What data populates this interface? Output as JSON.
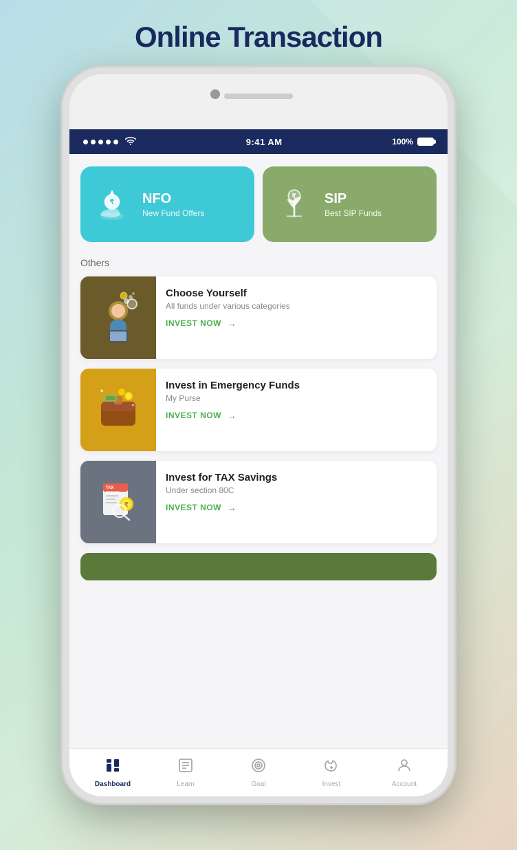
{
  "page": {
    "title": "Online Transaction",
    "background_gradient": "linear-gradient(135deg, #b8dde8, #c5e8d5, #d4ecd8, #e8d4c0)"
  },
  "status_bar": {
    "time": "9:41 AM",
    "battery": "100%",
    "signal_dots": 5
  },
  "top_cards": [
    {
      "id": "nfo",
      "title": "NFO",
      "subtitle": "New Fund Offers",
      "color": "#3ec9d6",
      "icon": "nfo-icon"
    },
    {
      "id": "sip",
      "title": "SIP",
      "subtitle": "Best SIP Funds",
      "color": "#8aaa6b",
      "icon": "sip-icon"
    }
  ],
  "others_label": "Others",
  "list_items": [
    {
      "title": "Choose Yourself",
      "subtitle": "All funds under various categories",
      "cta": "INVEST NOW",
      "bg_color": "brown",
      "icon": "choose-yourself-icon"
    },
    {
      "title": "Invest in Emergency Funds",
      "subtitle": "My Purse",
      "cta": "INVEST NOW",
      "bg_color": "gold",
      "icon": "emergency-funds-icon"
    },
    {
      "title": "Invest for TAX Savings",
      "subtitle": "Under section 80C",
      "cta": "INVEST NOW",
      "bg_color": "slate",
      "icon": "tax-savings-icon"
    }
  ],
  "bottom_nav": [
    {
      "id": "dashboard",
      "label": "Dashboard",
      "active": true
    },
    {
      "id": "learn",
      "label": "Learn",
      "active": false
    },
    {
      "id": "goal",
      "label": "Goal",
      "active": false
    },
    {
      "id": "invest",
      "label": "Invest",
      "active": false
    },
    {
      "id": "account",
      "label": "Account",
      "active": false
    }
  ]
}
